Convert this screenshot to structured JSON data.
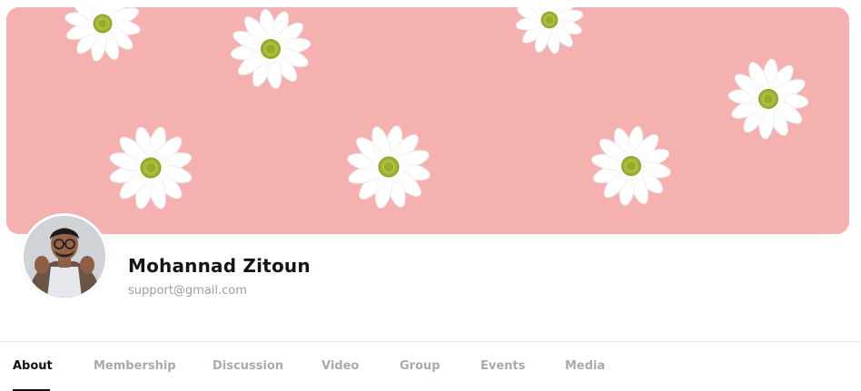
{
  "profile": {
    "name": "Mohannad Zitoun",
    "email": "support@gmail.com"
  },
  "tabs": [
    {
      "label": "About",
      "active": true
    },
    {
      "label": "Membership",
      "active": false
    },
    {
      "label": "Discussion",
      "active": false
    },
    {
      "label": "Video",
      "active": false
    },
    {
      "label": "Group",
      "active": false
    },
    {
      "label": "Events",
      "active": false
    },
    {
      "label": "Media",
      "active": false
    }
  ],
  "colors": {
    "cover_background": "#f5b1b0",
    "active_tab": "#121212",
    "inactive_tab": "#a7aab0",
    "email_text": "#9b9ea3"
  },
  "icons": {
    "cover": "pink-background-with-white-flowers",
    "avatar": "profile-photo"
  }
}
